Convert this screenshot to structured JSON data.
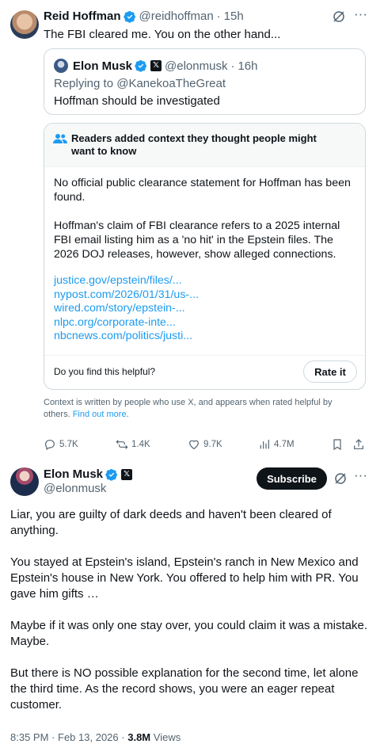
{
  "tweet1": {
    "name": "Reid Hoffman",
    "handle": "@reidhoffman",
    "dot": "·",
    "time": "15h",
    "text": "The FBI cleared me. You on the other hand...",
    "quote": {
      "name": "Elon Musk",
      "handle": "@elonmusk",
      "dot": "·",
      "time": "16h",
      "replying_prefix": "Replying to ",
      "replying_to": "@KanekoaTheGreat",
      "text": "Hoffman should be investigated"
    },
    "note": {
      "title": "Readers added context they thought people might want to know",
      "para1": "No official public clearance statement for Hoffman has been found.",
      "para2": "Hoffman's claim of FBI clearance refers to a 2025 internal FBI email listing him as a 'no hit' in the Epstein files. The 2026 DOJ releases, however, show alleged connections.",
      "links": [
        "justice.gov/epstein/files/...",
        "nypost.com/2026/01/31/us-...",
        "wired.com/story/epstein-...",
        "nlpc.org/corporate-inte...",
        "nbcnews.com/politics/justi..."
      ],
      "helpful_question": "Do you find this helpful?",
      "rate_label": "Rate it"
    },
    "context_text": "Context is written by people who use X, and appears when rated helpful by others.",
    "context_link": "Find out more",
    "context_end": ".",
    "stats": {
      "replies": "5.7K",
      "reposts": "1.4K",
      "likes": "9.7K",
      "views": "4.7M"
    }
  },
  "tweet2": {
    "name": "Elon Musk",
    "handle": "@elonmusk",
    "subscribe_label": "Subscribe",
    "paragraphs": [
      "Liar, you are guilty of dark deeds and haven't been cleared of anything.",
      "You stayed at Epstein's island, Epstein's ranch in New Mexico and Epstein's house in New York. You offered to help him with PR. You gave him gifts …",
      "Maybe if it was only one stay over, you could claim it was a mistake. Maybe.",
      "But there is NO possible explanation for the second time, let alone the third time. As the record shows, you were an eager repeat customer."
    ],
    "time": "8:35 PM",
    "dot": "·",
    "date": "Feb 13, 2026",
    "views_count": "3.8M",
    "views_label": "Views"
  },
  "colors": {
    "accent": "#1d9bf0",
    "text": "#0f1419",
    "secondary": "#536471",
    "border": "#cfd9de"
  },
  "icons": [
    "verified-badge-icon",
    "x-badge-icon",
    "grok-icon",
    "more-icon",
    "people-icon",
    "reply-icon",
    "repost-icon",
    "like-icon",
    "views-icon",
    "bookmark-icon",
    "share-icon"
  ]
}
